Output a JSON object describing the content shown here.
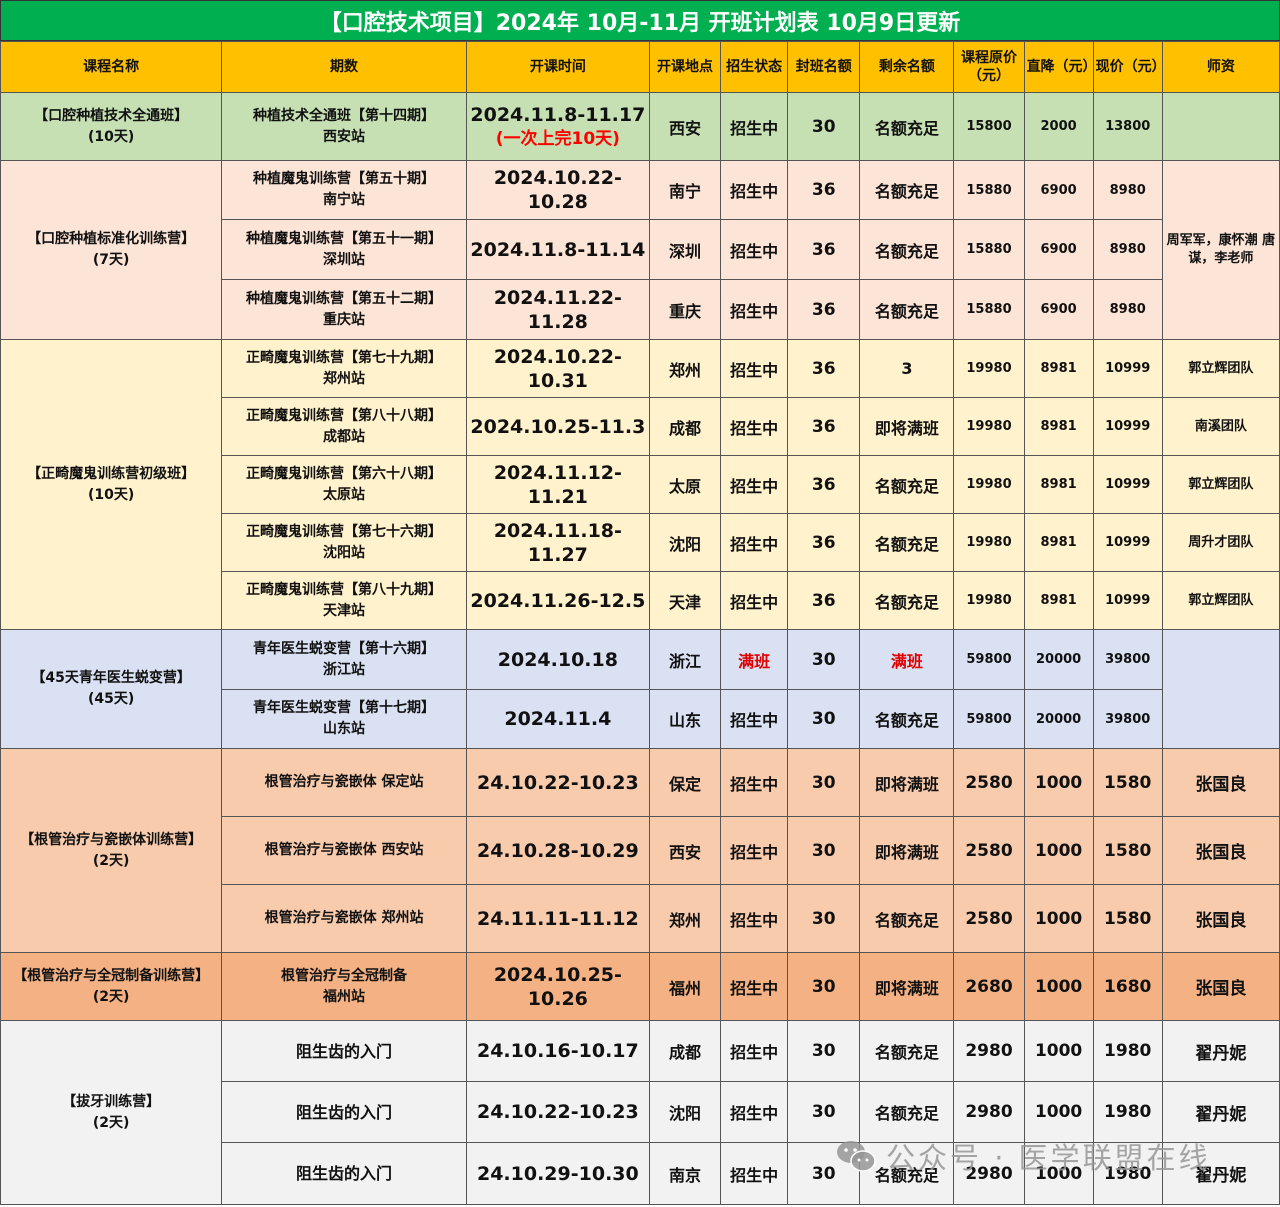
{
  "title": "【口腔技术项目】2024年 10月-11月 开班计划表 10月9日更新",
  "headers": {
    "course": "课程名称",
    "session": "期数",
    "date": "开课时间",
    "location": "开课地点",
    "status": "招生状态",
    "seats": "封班名额",
    "remaining": "剩余名额",
    "original_price": "课程原价（元）",
    "discount": "直降（元）",
    "current_price": "现价（元）",
    "teacher": "师资"
  },
  "groups": [
    {
      "course": "【口腔种植技术全通班】",
      "duration": "(10天)",
      "teacher": "",
      "rows": [
        {
          "session": "种植技术全通班【第十四期】",
          "station": "西安站",
          "date": "2024.11.8-11.17",
          "date_note": "(一次上完10天)",
          "location": "西安",
          "status": "招生中",
          "seats": "30",
          "remaining": "名额充足",
          "original": "15800",
          "discount": "2000",
          "current": "13800"
        }
      ]
    },
    {
      "course": "【口腔种植标准化训练营】",
      "duration": "(7天)",
      "teacher": "周军军，康怀潮 唐谋，李老师",
      "rows": [
        {
          "session": "种植魔鬼训练营【第五十期】",
          "station": "南宁站",
          "date": "2024.10.22-10.28",
          "location": "南宁",
          "status": "招生中",
          "seats": "36",
          "remaining": "名额充足",
          "original": "15880",
          "discount": "6900",
          "current": "8980"
        },
        {
          "session": "种植魔鬼训练营【第五十一期】",
          "station": "深圳站",
          "date": "2024.11.8-11.14",
          "location": "深圳",
          "status": "招生中",
          "seats": "36",
          "remaining": "名额充足",
          "original": "15880",
          "discount": "6900",
          "current": "8980"
        },
        {
          "session": "种植魔鬼训练营【第五十二期】",
          "station": "重庆站",
          "date": "2024.11.22-11.28",
          "location": "重庆",
          "status": "招生中",
          "seats": "36",
          "remaining": "名额充足",
          "original": "15880",
          "discount": "6900",
          "current": "8980"
        }
      ]
    },
    {
      "course": "【正畸魔鬼训练营初级班】",
      "duration": "(10天)",
      "rows": [
        {
          "session": "正畸魔鬼训练营【第七十九期】",
          "station": "郑州站",
          "date": "2024.10.22-10.31",
          "location": "郑州",
          "status": "招生中",
          "seats": "36",
          "remaining": "3",
          "original": "19980",
          "discount": "8981",
          "current": "10999",
          "teacher": "郭立辉团队"
        },
        {
          "session": "正畸魔鬼训练营【第八十八期】",
          "station": "成都站",
          "date": "2024.10.25-11.3",
          "location": "成都",
          "status": "招生中",
          "seats": "36",
          "remaining": "即将满班",
          "original": "19980",
          "discount": "8981",
          "current": "10999",
          "teacher": "南溪团队"
        },
        {
          "session": "正畸魔鬼训练营【第六十八期】",
          "station": "太原站",
          "date": "2024.11.12-11.21",
          "location": "太原",
          "status": "招生中",
          "seats": "36",
          "remaining": "名额充足",
          "original": "19980",
          "discount": "8981",
          "current": "10999",
          "teacher": "郭立辉团队"
        },
        {
          "session": "正畸魔鬼训练营【第七十六期】",
          "station": "沈阳站",
          "date": "2024.11.18-11.27",
          "location": "沈阳",
          "status": "招生中",
          "seats": "36",
          "remaining": "名额充足",
          "original": "19980",
          "discount": "8981",
          "current": "10999",
          "teacher": "周升才团队"
        },
        {
          "session": "正畸魔鬼训练营【第八十九期】",
          "station": "天津站",
          "date": "2024.11.26-12.5",
          "location": "天津",
          "status": "招生中",
          "seats": "36",
          "remaining": "名额充足",
          "original": "19980",
          "discount": "8981",
          "current": "10999",
          "teacher": "郭立辉团队"
        }
      ]
    },
    {
      "course": "【45天青年医生蜕变营】",
      "duration": "(45天)",
      "teacher": "",
      "rows": [
        {
          "session": "青年医生蜕变营【第十六期】",
          "station": "浙江站",
          "date": "2024.10.18",
          "location": "浙江",
          "status": "满班",
          "seats": "30",
          "remaining": "满班",
          "original": "59800",
          "discount": "20000",
          "current": "39800"
        },
        {
          "session": "青年医生蜕变营【第十七期】",
          "station": "山东站",
          "date": "2024.11.4",
          "location": "山东",
          "status": "招生中",
          "seats": "30",
          "remaining": "名额充足",
          "original": "59800",
          "discount": "20000",
          "current": "39800"
        }
      ]
    },
    {
      "course": "【根管治疗与瓷嵌体训练营】",
      "duration": "(2天)",
      "rows": [
        {
          "session": "根管治疗与瓷嵌体 保定站",
          "date": "24.10.22-10.23",
          "location": "保定",
          "status": "招生中",
          "seats": "30",
          "remaining": "即将满班",
          "original": "2580",
          "discount": "1000",
          "current": "1580",
          "teacher": "张国良"
        },
        {
          "session": "根管治疗与瓷嵌体 西安站",
          "date": "24.10.28-10.29",
          "location": "西安",
          "status": "招生中",
          "seats": "30",
          "remaining": "即将满班",
          "original": "2580",
          "discount": "1000",
          "current": "1580",
          "teacher": "张国良"
        },
        {
          "session": "根管治疗与瓷嵌体 郑州站",
          "date": "24.11.11-11.12",
          "location": "郑州",
          "status": "招生中",
          "seats": "30",
          "remaining": "名额充足",
          "original": "2580",
          "discount": "1000",
          "current": "1580",
          "teacher": "张国良"
        }
      ]
    },
    {
      "course": "【根管治疗与全冠制备训练营】",
      "duration": "(2天)",
      "rows": [
        {
          "session": "根管治疗与全冠制备",
          "station": "福州站",
          "date": "2024.10.25-10.26",
          "location": "福州",
          "status": "招生中",
          "seats": "30",
          "remaining": "即将满班",
          "original": "2680",
          "discount": "1000",
          "current": "1680",
          "teacher": "张国良"
        }
      ]
    },
    {
      "course": "【拔牙训练营】",
      "duration": "(2天)",
      "rows": [
        {
          "session": "阻生齿的入门",
          "date": "24.10.16-10.17",
          "location": "成都",
          "status": "招生中",
          "seats": "30",
          "remaining": "名额充足",
          "original": "2980",
          "discount": "1000",
          "current": "1980",
          "teacher": "翟丹妮"
        },
        {
          "session": "阻生齿的入门",
          "date": "24.10.22-10.23",
          "location": "沈阳",
          "status": "招生中",
          "seats": "30",
          "remaining": "名额充足",
          "original": "2980",
          "discount": "1000",
          "current": "1980",
          "teacher": "翟丹妮"
        },
        {
          "session": "阻生齿的入门",
          "date": "24.10.29-10.30",
          "location": "南京",
          "status": "招生中",
          "seats": "30",
          "remaining": "名额充足",
          "original": "2980",
          "discount": "1000",
          "current": "1980",
          "teacher": "翟丹妮"
        }
      ]
    }
  ],
  "watermark": "公众号 · 医学联盟在线",
  "colors": {
    "title_bg": "#00b050",
    "header_bg": "#ffc000",
    "full_text": "#e00000"
  }
}
